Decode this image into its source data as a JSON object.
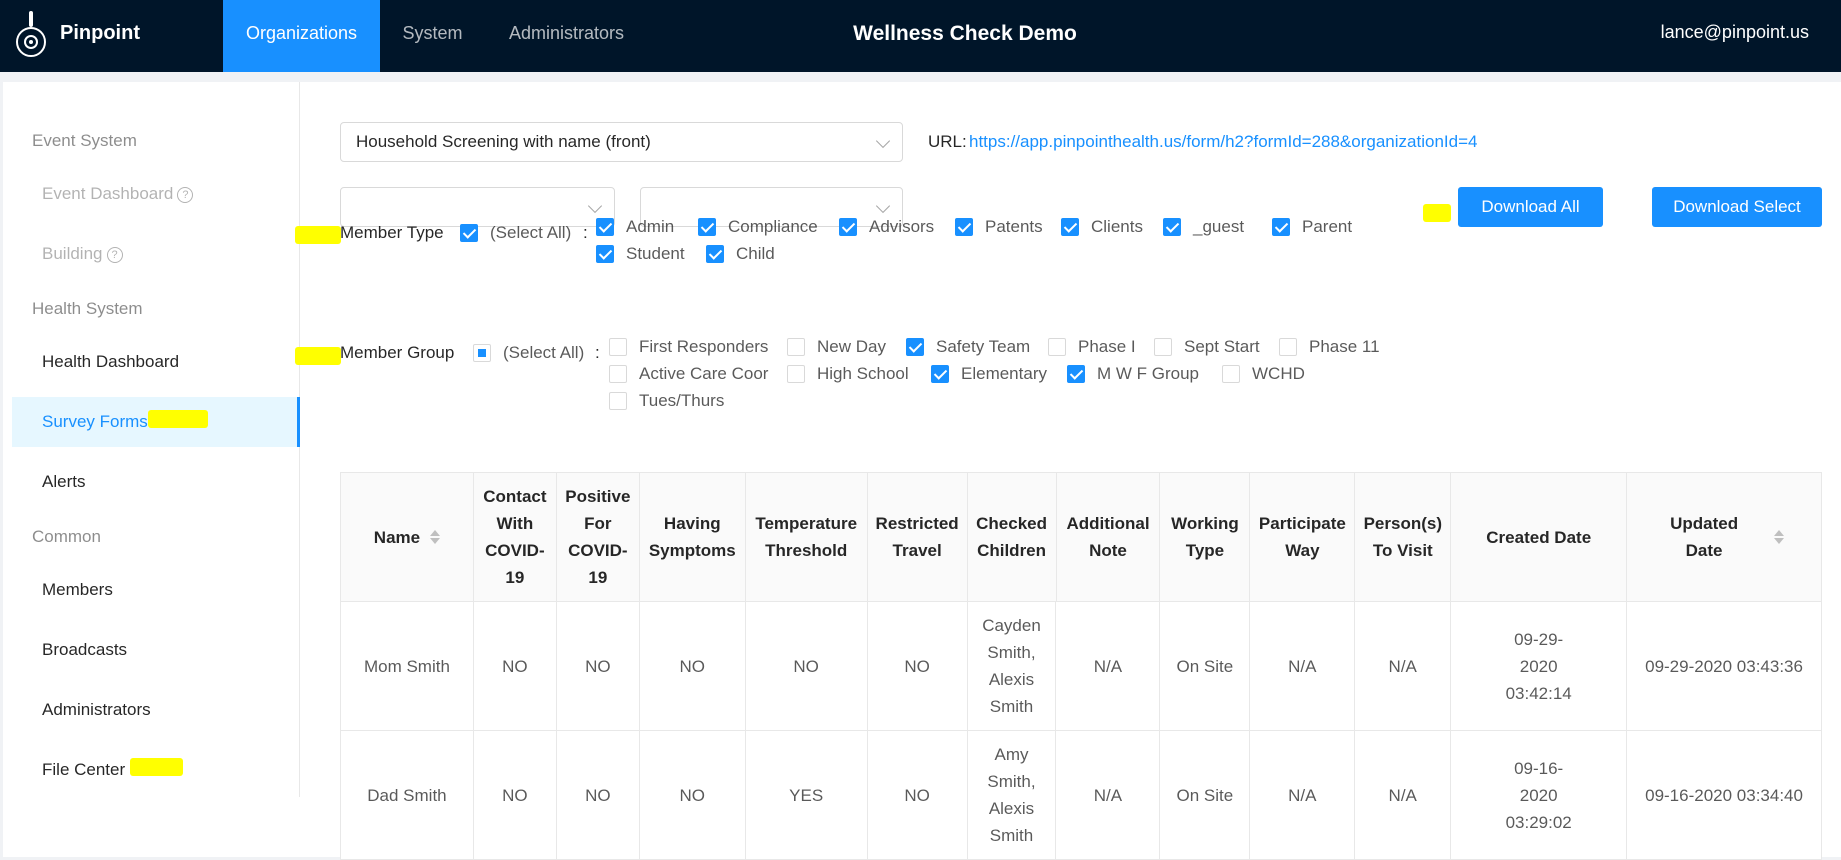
{
  "header": {
    "brand": "Pinpoint",
    "nav": [
      "Organizations",
      "System",
      "Administrators"
    ],
    "title": "Wellness Check Demo",
    "user": "lance@pinpoint.us"
  },
  "sidebar": {
    "groups": [
      "Event System",
      "Health System",
      "Common"
    ],
    "items": [
      "Event Dashboard",
      "Building",
      "Health Dashboard",
      "Survey Forms",
      "Alerts",
      "Members",
      "Broadcasts",
      "Administrators",
      "File Center"
    ],
    "help_glyph": "?"
  },
  "form": {
    "selected": "Household Screening with name (front)",
    "url_label": "URL:",
    "url": "https://app.pinpointhealth.us/form/h2?formId=288&organizationId=4"
  },
  "filters": {
    "select1": "",
    "select2": ""
  },
  "buttons": {
    "download_all": "Download All",
    "download_select": "Download Select"
  },
  "member_type": {
    "label": "Member Type",
    "select_all": "(Select All)",
    "colon": ":",
    "options": [
      "Admin",
      "Compliance",
      "Advisors",
      "Patents",
      "Clients",
      "_guest",
      "Parent",
      "Student",
      "Child"
    ]
  },
  "member_group": {
    "label": "Member Group",
    "select_all": "(Select All)",
    "colon": ":",
    "options": [
      "First Responders",
      "New Day",
      "Safety Team",
      "Phase I",
      "Sept Start",
      "Phase 11",
      "Active Care Coor",
      "High School",
      "Elementary",
      "M W F Group",
      "WCHD",
      "Tues/Thurs"
    ]
  },
  "table": {
    "headers": [
      "Name",
      "Contact With COVID-19",
      "Positive For COVID-19",
      "Having Symptoms",
      "Temperature Threshold",
      "Restricted Travel",
      "Checked Children",
      "Additional Note",
      "Working Type",
      "Participate Way",
      "Person(s) To Visit",
      "Created Date",
      "Updated Date"
    ],
    "rows": [
      [
        "Mom Smith",
        "NO",
        "NO",
        "NO",
        "NO",
        "NO",
        "Cayden Smith, Alexis Smith",
        "N/A",
        "On Site",
        "N/A",
        "N/A",
        "09-29-2020 03:42:14",
        "09-29-2020 03:43:36"
      ],
      [
        "Dad Smith",
        "NO",
        "NO",
        "NO",
        "YES",
        "NO",
        "Amy Smith, Alexis Smith",
        "N/A",
        "On Site",
        "N/A",
        "N/A",
        "09-16-2020 03:29:02",
        "09-16-2020 03:34:40"
      ]
    ]
  },
  "colors": {
    "nav_bg": "#001529",
    "accent": "#1890ff",
    "highlight": "#ffff00"
  }
}
